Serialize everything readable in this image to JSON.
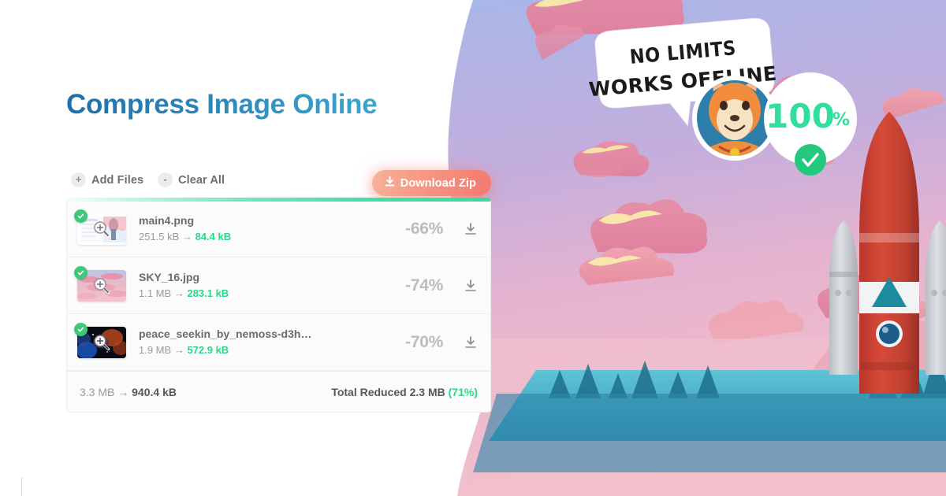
{
  "page": {
    "title": "Compress Image Online"
  },
  "toolbar": {
    "add_files": {
      "icon": "plus-icon",
      "symbol": "+",
      "label": "Add Files"
    },
    "clear_all": {
      "icon": "minus-icon",
      "symbol": "-",
      "label": "Clear All"
    },
    "download_zip": {
      "icon": "download-icon",
      "label": "Download Zip",
      "color": "#f4796f"
    }
  },
  "progress": {
    "percent": 100,
    "color_start": "#f2fffb",
    "color_end": "#3adc99"
  },
  "files": [
    {
      "name": "main4.png",
      "size_before": "251.5 kB",
      "arrow": "→",
      "size_after": "84.4 kB",
      "reduction": "-66%",
      "status": "done",
      "thumb": "screenshot-thumbnail"
    },
    {
      "name": "SKY_16.jpg",
      "size_before": "1.1 MB",
      "arrow": "→",
      "size_after": "283.1 kB",
      "reduction": "-74%",
      "status": "done",
      "thumb": "sky-thumbnail"
    },
    {
      "name": "peace_seekin_by_nemoss-d3h…",
      "size_before": "1.9 MB",
      "arrow": "→",
      "size_after": "572.9 kB",
      "reduction": "-70%",
      "status": "done",
      "thumb": "space-thumbnail"
    }
  ],
  "footer": {
    "total_before": "3.3 MB",
    "arrow": "→",
    "total_after": "940.4 kB",
    "total_reduced_label": "Total Reduced 2.3 MB",
    "total_reduced_percent": "(71%)"
  },
  "illustration": {
    "speech_bubble": {
      "line1": "NO LIMITS",
      "line2": "WORKS OFFLINE"
    },
    "progress_badge": {
      "value": "100",
      "unit": "%",
      "check": "✓",
      "color": "#2fdf9b"
    },
    "mascot": "fox-avatar",
    "scene": "rocket-launch-sunset"
  },
  "colors": {
    "title_blue": "#2d86b8",
    "green": "#27d88b",
    "coral": "#f4796f",
    "gray_text": "#6b6b6b"
  }
}
